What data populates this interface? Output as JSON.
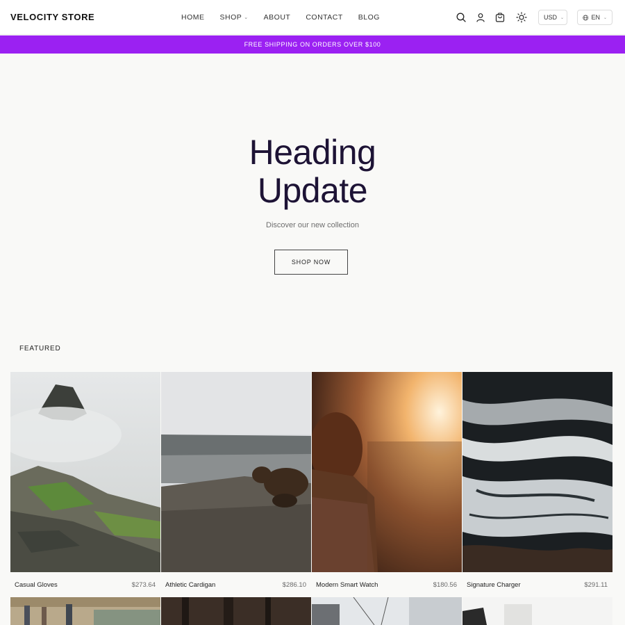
{
  "header": {
    "logo": "VELOCITY STORE",
    "nav": [
      {
        "label": "HOME"
      },
      {
        "label": "SHOP"
      },
      {
        "label": "ABOUT"
      },
      {
        "label": "CONTACT"
      },
      {
        "label": "BLOG"
      }
    ],
    "icons": [
      "search-icon",
      "user-icon",
      "cart-icon",
      "sun-icon"
    ],
    "currency": "USD",
    "language": "EN"
  },
  "announcement": "FREE SHIPPING ON ORDERS OVER $100",
  "hero": {
    "title_line1": "Heading",
    "title_line2": "Update",
    "subtitle": "Discover our new collection",
    "cta": "SHOP NOW"
  },
  "featured": {
    "label": "FEATURED",
    "products": [
      {
        "name": "Casual Gloves",
        "price": "$273.64"
      },
      {
        "name": "Athletic Cardigan",
        "price": "$286.10"
      },
      {
        "name": "Modern Smart Watch",
        "price": "$180.56"
      },
      {
        "name": "Signature Charger",
        "price": "$291.11"
      }
    ]
  },
  "colors": {
    "accent": "#9b21f2",
    "hero_title": "#1d1335",
    "background": "#f9f9f7"
  }
}
